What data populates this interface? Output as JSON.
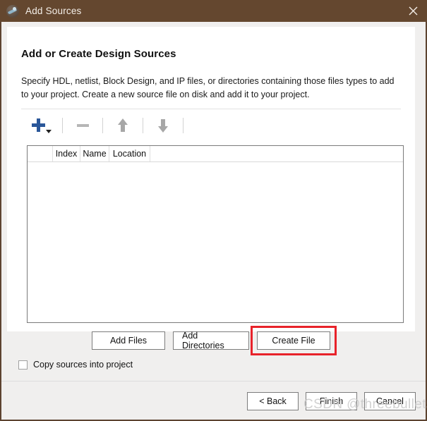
{
  "window": {
    "title": "Add Sources",
    "icon": "vivado-app-icon",
    "close_label": "✕",
    "titlebar_color": "#64472f"
  },
  "content": {
    "heading": "Add or Create Design Sources",
    "description": "Specify HDL, netlist, Block Design, and IP files, or directories containing those files types to add to your project. Create a new source file on disk and add it to your project."
  },
  "toolbar": {
    "add_label": "+",
    "add_icon": "plus-icon",
    "add_dropdown_icon": "caret-down-icon",
    "remove_icon": "minus-icon",
    "move_up_icon": "arrow-up-icon",
    "move_down_icon": "arrow-down-icon"
  },
  "table": {
    "columns": [
      "",
      "Index",
      "Name",
      "Location"
    ],
    "rows": []
  },
  "mid_buttons": [
    {
      "label": "Add Files",
      "name": "add-files-button"
    },
    {
      "label": "Add Directories",
      "name": "add-directories-button"
    },
    {
      "label": "Create File",
      "name": "create-file-button"
    }
  ],
  "mid_buttons_labels": {
    "add_files": "Add Files",
    "add_directories": "Add Directories",
    "create_file": "Create File"
  },
  "highlight": {
    "target": "Create File",
    "color": "#e8222a"
  },
  "checkbox": {
    "label": "Copy sources into project",
    "checked": false
  },
  "footer": {
    "back": "< Back",
    "finish": "Finish",
    "cancel": "Cancel"
  },
  "watermark": {
    "text": "CSDN @threebullets"
  }
}
